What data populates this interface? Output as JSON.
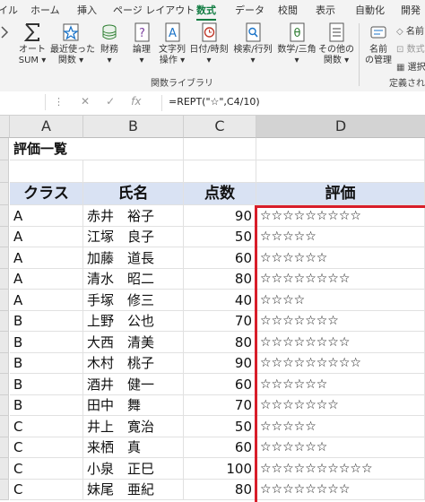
{
  "ribbon": {
    "tabs": [
      "イル",
      "ホーム",
      "挿入",
      "ページ レイアウト",
      "数式",
      "データ",
      "校閲",
      "表示",
      "自動化",
      "開発"
    ],
    "active_tab": "数式",
    "tools": [
      {
        "label": "オート\nSUM ▾",
        "icon": "sigma-icon"
      },
      {
        "label": "最近使った\n関数 ▾",
        "icon": "star-icon"
      },
      {
        "label": "財務\n▾",
        "icon": "coins-icon"
      },
      {
        "label": "論理\n▾",
        "icon": "question-book-icon"
      },
      {
        "label": "文字列\n操作 ▾",
        "icon": "text-book-icon"
      },
      {
        "label": "日付/時刻\n▾",
        "icon": "clock-book-icon"
      },
      {
        "label": "検索/行列\n▾",
        "icon": "search-book-icon"
      },
      {
        "label": "数学/三角\n▾",
        "icon": "theta-book-icon"
      },
      {
        "label": "その他の\n関数 ▾",
        "icon": "more-book-icon"
      }
    ],
    "group_label": "関数ライブラリ",
    "names": {
      "manager": "名前\nの管理",
      "item1": "名前",
      "item2": "数式",
      "item3": "選択",
      "group": "定義され"
    }
  },
  "formula_bar": {
    "dots": "⋮",
    "cancel": "✕",
    "enter": "✓",
    "fx": "fx",
    "formula": "=REPT(\"☆\",C4/10)"
  },
  "columns": [
    "A",
    "B",
    "C",
    "D"
  ],
  "title": "評価一覧",
  "headers": {
    "class": "クラス",
    "name": "氏名",
    "score": "点数",
    "rating": "評価"
  },
  "rows": [
    {
      "class": "A",
      "name": "赤井　裕子",
      "score": "90",
      "stars": "☆☆☆☆☆☆☆☆☆"
    },
    {
      "class": "A",
      "name": "江塚　良子",
      "score": "50",
      "stars": "☆☆☆☆☆"
    },
    {
      "class": "A",
      "name": "加藤　道長",
      "score": "60",
      "stars": "☆☆☆☆☆☆"
    },
    {
      "class": "A",
      "name": "清水　昭二",
      "score": "80",
      "stars": "☆☆☆☆☆☆☆☆"
    },
    {
      "class": "A",
      "name": "手塚　修三",
      "score": "40",
      "stars": "☆☆☆☆"
    },
    {
      "class": "B",
      "name": "上野　公也",
      "score": "70",
      "stars": "☆☆☆☆☆☆☆"
    },
    {
      "class": "B",
      "name": "大西　清美",
      "score": "80",
      "stars": "☆☆☆☆☆☆☆☆"
    },
    {
      "class": "B",
      "name": "木村　桃子",
      "score": "90",
      "stars": "☆☆☆☆☆☆☆☆☆"
    },
    {
      "class": "B",
      "name": "酒井　健一",
      "score": "60",
      "stars": "☆☆☆☆☆☆"
    },
    {
      "class": "B",
      "name": "田中　舞",
      "score": "70",
      "stars": "☆☆☆☆☆☆☆"
    },
    {
      "class": "C",
      "name": "井上　寛治",
      "score": "50",
      "stars": "☆☆☆☆☆"
    },
    {
      "class": "C",
      "name": "来栖　真",
      "score": "60",
      "stars": "☆☆☆☆☆☆"
    },
    {
      "class": "C",
      "name": "小泉　正巳",
      "score": "100",
      "stars": "☆☆☆☆☆☆☆☆☆☆"
    },
    {
      "class": "C",
      "name": "妹尾　亜紀",
      "score": "80",
      "stars": "☆☆☆☆☆☆☆☆"
    }
  ],
  "colors": {
    "accent": "#107c41",
    "header_fill": "#d9e2f3",
    "highlight": "#d81e2a"
  }
}
